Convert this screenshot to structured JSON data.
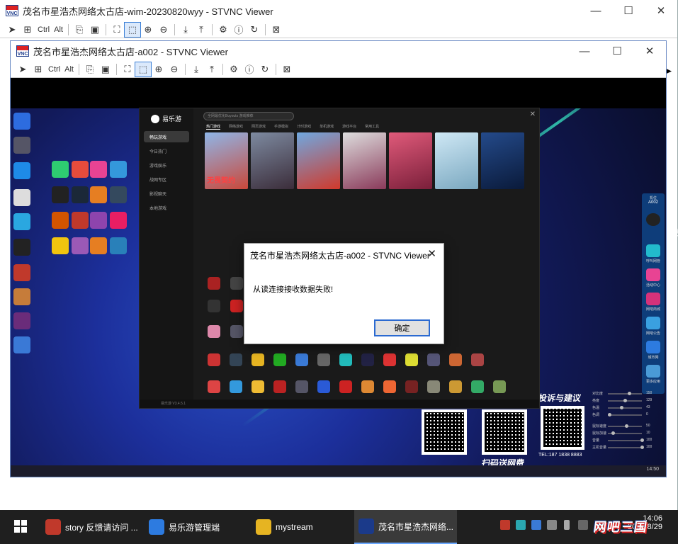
{
  "outer_window": {
    "title": "茂名市星浩杰网络太古店-wim-20230820wyy - STVNC Viewer",
    "toolbar": {
      "ctrl": "Ctrl",
      "alt": "Alt"
    }
  },
  "inner_window": {
    "title": "茂名市星浩杰网络太古店-a002 - STVNC Viewer",
    "toolbar": {
      "ctrl": "Ctrl",
      "alt": "Alt"
    }
  },
  "window_controls": {
    "minimize": "—",
    "maximize": "☐",
    "close": "✕"
  },
  "remote": {
    "app": {
      "name": "易乐游",
      "search_placeholder": "全网最优化Buyouts 游戏推荐",
      "tabs": [
        "热门游戏",
        "网络游戏",
        "网页游戏",
        "手游模拟",
        "计时游戏",
        "单机游戏",
        "游戏平台",
        "常用工具"
      ],
      "nav": [
        "畅玩游戏",
        "今日热门",
        "游戏娱乐",
        "战网专区",
        "影视聊天",
        "本地游戏"
      ],
      "banner_text": "无畏契约",
      "footer": "易乐游 V3.4.5.1",
      "close": "✕"
    },
    "panel": {
      "top_label": "机位",
      "seat": "A002",
      "items": [
        "呼叫网管",
        "活动中心",
        "网吧商城",
        "网吧公告",
        "城市网",
        "更多应用"
      ]
    },
    "qr_caption_top": "投诉与建议",
    "qr_caption_bottom": "扫码送网费",
    "phone": "TEL:187 1838 8883",
    "sliders": [
      {
        "label": "对比度",
        "value": "150",
        "pos": 0.6
      },
      {
        "label": "亮度",
        "value": "129",
        "pos": 0.45
      },
      {
        "label": "色温",
        "value": "43",
        "pos": 0.35
      },
      {
        "label": "色调",
        "value": "0",
        "pos": 0.0
      },
      {
        "label": "鼠标速度",
        "value": "50",
        "pos": 0.5
      },
      {
        "label": "鼠标加速",
        "value": "10",
        "pos": 0.1
      },
      {
        "label": "音量",
        "value": "100",
        "pos": 1.0
      },
      {
        "label": "主机音量",
        "value": "100",
        "pos": 1.0
      }
    ]
  },
  "dialog": {
    "title": "茂名市星浩杰网络太古店-a002 - STVNC Viewer",
    "message": "从读连接接收数据失败!",
    "ok": "确定",
    "close": "✕"
  },
  "taskbar": {
    "tasks": [
      {
        "label": "story 反馈请访问 ...",
        "color": "#c0392b"
      },
      {
        "label": "易乐游管理端",
        "color": "#2d7be0"
      },
      {
        "label": "mystream",
        "color": "#e6b422"
      },
      {
        "label": "茂名市星浩杰网络...",
        "color": "#1b3a8a"
      }
    ],
    "time": "14:06",
    "date": "2023/8/29"
  },
  "watermark": "网吧三国",
  "colors": {
    "accent": "#2b6ad1",
    "taskbar": "#1f1f1f"
  }
}
